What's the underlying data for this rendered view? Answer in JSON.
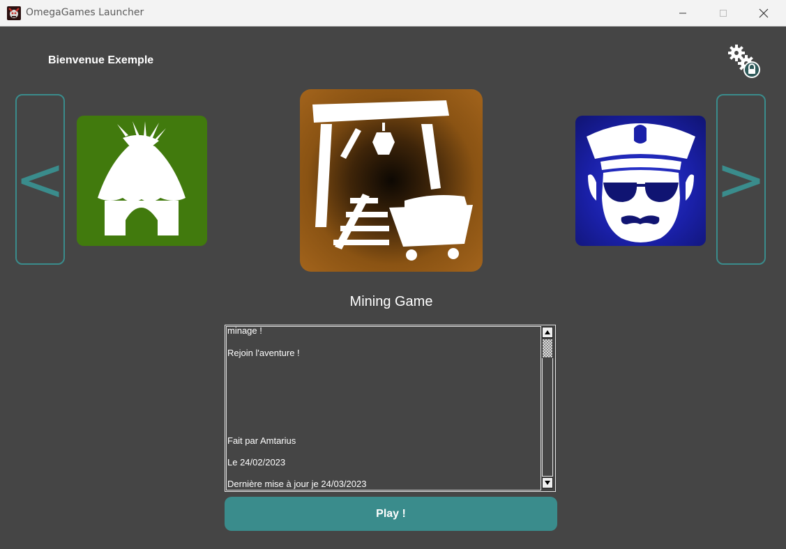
{
  "window": {
    "title": "OmegaGames Launcher",
    "controls": [
      "minimize-icon",
      "maximize-icon",
      "close-icon"
    ]
  },
  "header": {
    "greeting": "Bienvenue Exemple",
    "settings_icon": "locked-gears-icon"
  },
  "carousel": {
    "prev_label": "<",
    "next_label": ">",
    "games": [
      {
        "icon": "hut-icon",
        "color": "#417a0d",
        "position": "left"
      },
      {
        "icon": "mine-cart-icon",
        "color": "#a3641c",
        "position": "center",
        "selected": true
      },
      {
        "icon": "police-officer-icon",
        "color": "#1a20a8",
        "position": "right"
      }
    ],
    "accent": "#3a8c8c"
  },
  "selected_game": {
    "title": "Mining Game",
    "description_lines": [
      "minage !",
      "Rejoin l'aventure !",
      "Fait par Amtarius",
      "Le 24/02/2023",
      "Dernière mise à jour je 24/03/2023"
    ]
  },
  "actions": {
    "play_label": "Play !"
  }
}
